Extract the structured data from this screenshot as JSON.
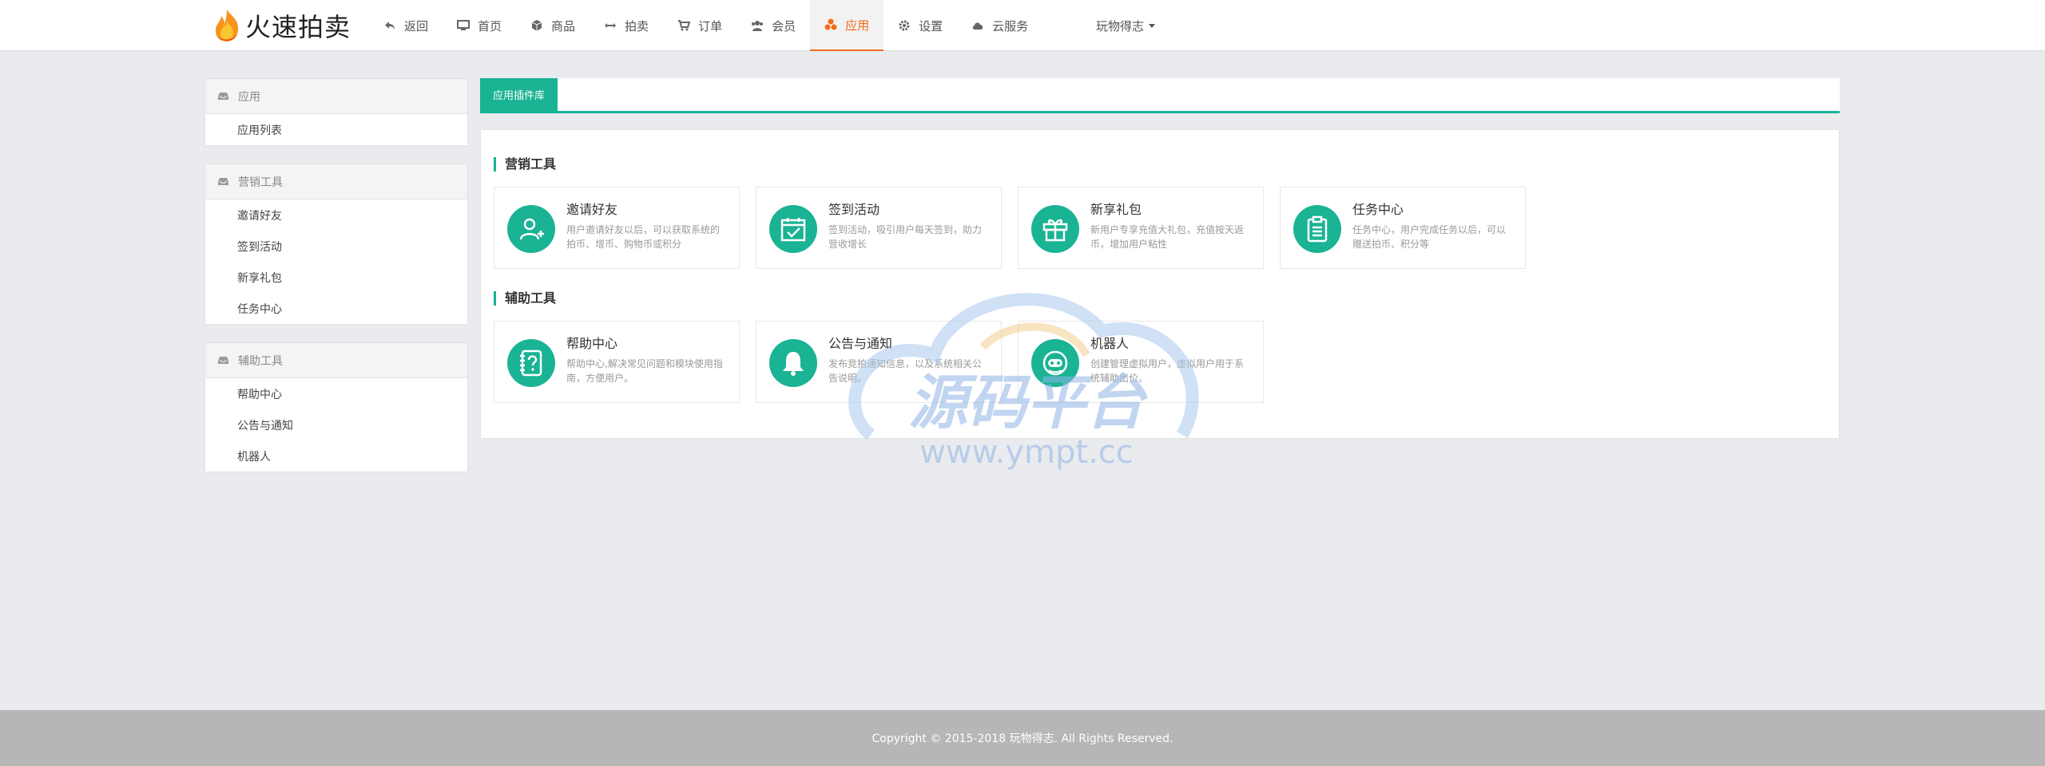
{
  "brand": {
    "name": "火速拍卖"
  },
  "nav": {
    "items": [
      {
        "label": "返回",
        "icon": "reply-icon"
      },
      {
        "label": "首页",
        "icon": "desktop-icon"
      },
      {
        "label": "商品",
        "icon": "cube-icon"
      },
      {
        "label": "拍卖",
        "icon": "arrows-h-icon"
      },
      {
        "label": "订单",
        "icon": "cart-icon"
      },
      {
        "label": "会员",
        "icon": "users-icon"
      },
      {
        "label": "应用",
        "icon": "apps-icon",
        "active": true
      },
      {
        "label": "设置",
        "icon": "gear-icon"
      },
      {
        "label": "云服务",
        "icon": "cloud-icon"
      }
    ],
    "user": "玩物得志"
  },
  "sidebar": {
    "groups": [
      {
        "title": "应用",
        "items": [
          "应用列表"
        ]
      },
      {
        "title": "营销工具",
        "items": [
          "邀请好友",
          "签到活动",
          "新享礼包",
          "任务中心"
        ]
      },
      {
        "title": "辅助工具",
        "items": [
          "帮助中心",
          "公告与通知",
          "机器人"
        ]
      }
    ]
  },
  "main": {
    "tab": "应用插件库",
    "sections": [
      {
        "title": "营销工具",
        "cards": [
          {
            "title": "邀请好友",
            "desc": "用户邀请好友以后，可以获取系统的拍币、增币、购物币或积分",
            "icon": "user-plus-icon"
          },
          {
            "title": "签到活动",
            "desc": "签到活动，吸引用户每天签到，助力营收增长",
            "icon": "calendar-check-icon"
          },
          {
            "title": "新享礼包",
            "desc": "新用户专享充值大礼包，充值按天返币，增加用户粘性",
            "icon": "gift-icon"
          },
          {
            "title": "任务中心",
            "desc": "任务中心，用户完成任务以后，可以赠送拍币、积分等",
            "icon": "clipboard-icon"
          }
        ]
      },
      {
        "title": "辅助工具",
        "cards": [
          {
            "title": "帮助中心",
            "desc": "帮助中心,解决常见问题和模块使用指南，方便用户。",
            "icon": "question-book-icon"
          },
          {
            "title": "公告与通知",
            "desc": "发布竞拍通知信息，以及系统相关公告说明。",
            "icon": "bell-icon"
          },
          {
            "title": "机器人",
            "desc": "创建管理虚拟用户，虚拟用户用于系统辅助出价。",
            "icon": "robot-icon"
          }
        ]
      }
    ]
  },
  "watermark": {
    "title": "源码平台",
    "url": "www.ympt.cc"
  },
  "footer": {
    "copyright": "Copyright © 2015-2018 玩物得志. All Rights Reserved."
  },
  "colors": {
    "accent": "#1ab394",
    "nav_active": "#f26a1b",
    "footer_bg": "#b6b6b6",
    "page_bg": "#e9ebee"
  }
}
